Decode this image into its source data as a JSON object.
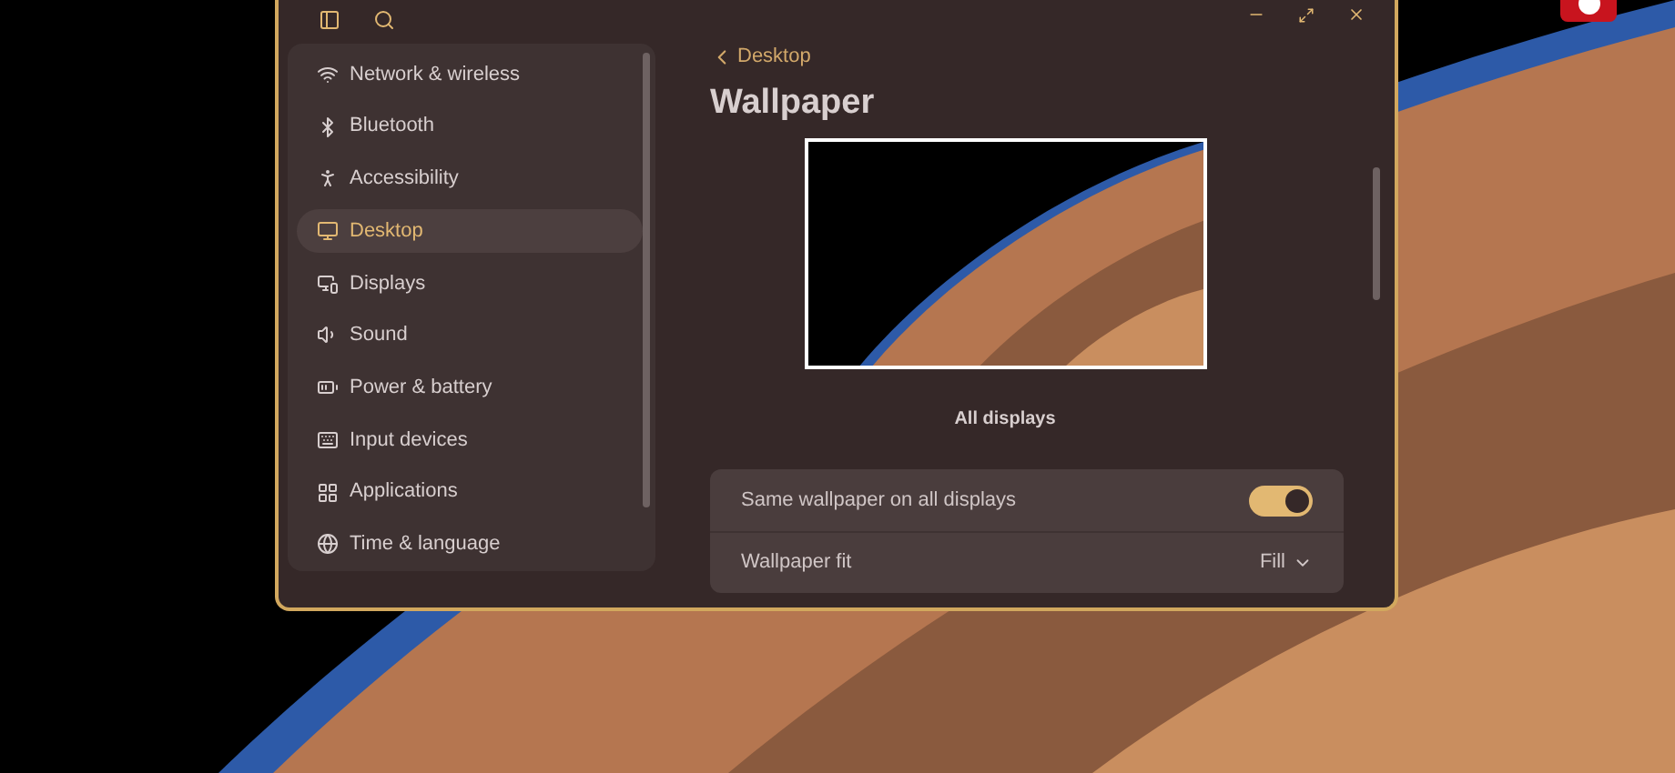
{
  "sidebar": {
    "items": [
      {
        "label": "Network & wireless",
        "selected": false
      },
      {
        "label": "Bluetooth",
        "selected": false
      },
      {
        "label": "Accessibility",
        "selected": false
      },
      {
        "label": "Desktop",
        "selected": true
      },
      {
        "label": "Displays",
        "selected": false
      },
      {
        "label": "Sound",
        "selected": false
      },
      {
        "label": "Power & battery",
        "selected": false
      },
      {
        "label": "Input devices",
        "selected": false
      },
      {
        "label": "Applications",
        "selected": false
      },
      {
        "label": "Time & language",
        "selected": false
      }
    ]
  },
  "content": {
    "back_link": "Desktop",
    "title": "Wallpaper",
    "preview_caption": "All displays",
    "settings": [
      {
        "kind": "toggle",
        "label": "Same wallpaper on all displays",
        "on": true
      },
      {
        "kind": "dropdown",
        "label": "Wallpaper fit",
        "value": "Fill"
      }
    ]
  }
}
